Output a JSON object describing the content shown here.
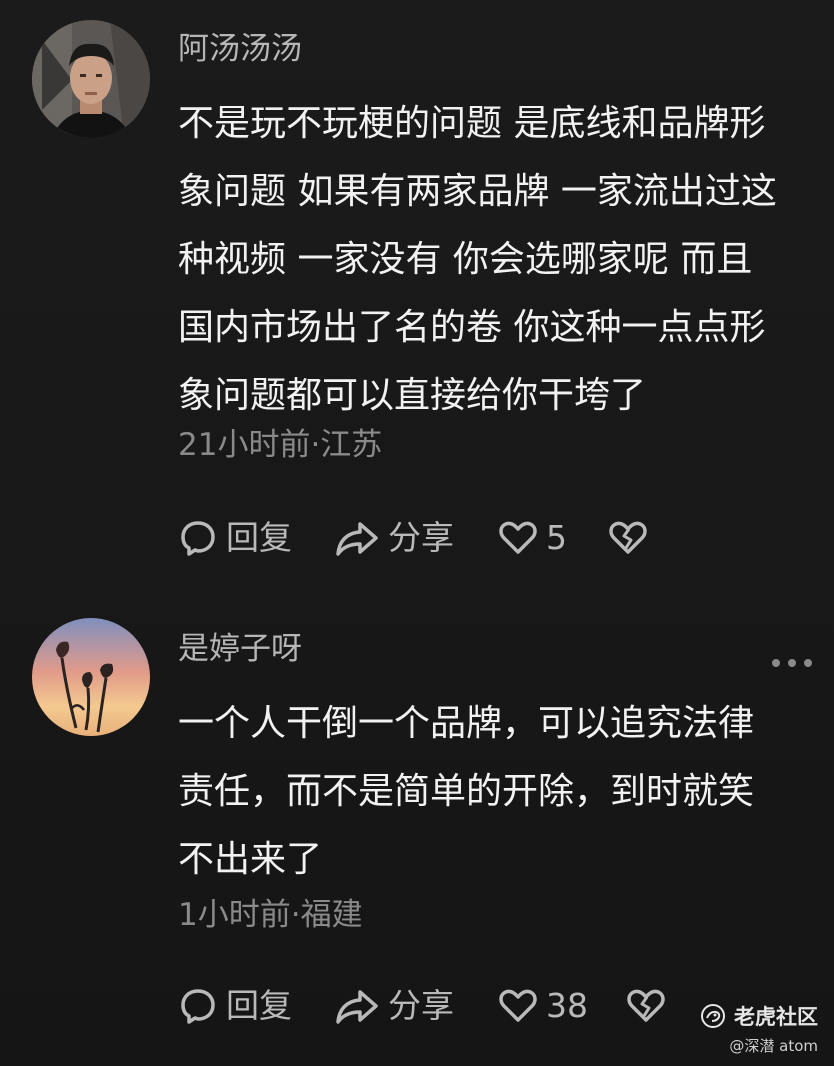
{
  "comments": [
    {
      "username": "阿汤汤汤",
      "text_lines": [
        "不是玩不玩梗的问题 是底线和品牌形",
        "象问题 如果有两家品牌 一家流出过这",
        "种视频 一家没有 你会选哪家呢 而且",
        "国内市场出了名的卷 你这种一点点形",
        "象问题都可以直接给你干垮了"
      ],
      "meta": "21小时前·江苏",
      "reply_label": "回复",
      "share_label": "分享",
      "like_count": "5"
    },
    {
      "username": "是婷子呀",
      "text_lines": [
        "一个人干倒一个品牌，可以追究法律",
        "责任，而不是简单的开除，到时就笑",
        "不出来了"
      ],
      "meta": "1小时前·福建",
      "reply_label": "回复",
      "share_label": "分享",
      "like_count": "38"
    }
  ],
  "watermark": {
    "brand": "老虎社区",
    "handle": "@深潜 atom"
  },
  "icons": {
    "reply": "speech-bubble-icon",
    "share": "share-arrow-icon",
    "like": "heart-icon",
    "dislike": "broken-heart-icon",
    "more": "more-dots-icon"
  }
}
